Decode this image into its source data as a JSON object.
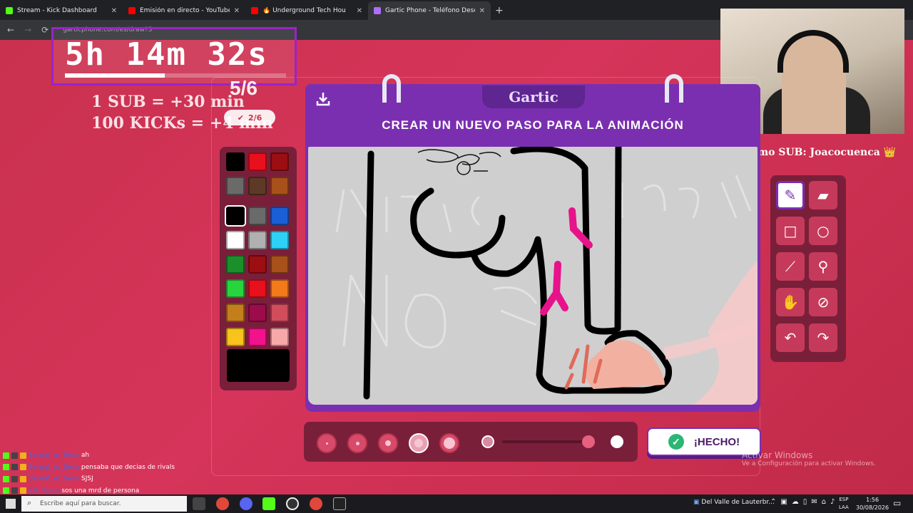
{
  "browser": {
    "tabs": [
      {
        "title": "Stream - Kick Dashboard",
        "favicon_color": "#53fc18",
        "active": false
      },
      {
        "title": "Emisión en directo - YouTube S",
        "favicon_color": "#ff0000",
        "active": false
      },
      {
        "title": "🔥 Underground Tech Hou",
        "favicon_color": "#ff0000",
        "active": false
      },
      {
        "title": "Gartic Phone - Teléfono Descor",
        "favicon_color": "#b06cff",
        "active": true
      }
    ],
    "url": "garticphone.com/es/draw?5"
  },
  "overlay": {
    "timer": "5h 14m 32s",
    "timer_progress_fraction": 0.45,
    "sub_rule_1": "1 SUB = +30 min",
    "sub_rule_2": "100 KICKs = +4 min",
    "round_counter": "5/6",
    "done_count": "2/6",
    "last_sub": "Ultimo SUB: Joacocuenca 👑"
  },
  "gartic": {
    "logo": "Gartic",
    "step_title": "CREAR UN NUEVO PASO PARA LA ANIMACIÓN",
    "done_button": "¡HECHO!",
    "palette_colors": [
      "#000000",
      "#e8101c",
      "#9b0e12",
      "#6a6a6a",
      "#5c3a26",
      "#a8511a",
      "#000000",
      "#6a6a6a",
      "#1a5fd6",
      "#ffffff",
      "#b0b0b0",
      "#2ed0f5",
      "#1a8f2a",
      "#9b0e12",
      "#a8511a",
      "#27d43d",
      "#e8101c",
      "#f27a1a",
      "#c47e1c",
      "#9c0b4a",
      "#d24d5c",
      "#f7c31c",
      "#f2128a",
      "#f7a9a9"
    ],
    "current_color": "#000000",
    "tools": [
      "pencil-icon",
      "eraser-icon",
      "square-icon",
      "circle-icon",
      "line-icon",
      "eyedropper-icon",
      "fill-icon",
      "clear-icon",
      "undo-icon",
      "redo-icon"
    ],
    "brush_size_selected": 4,
    "opacity_fraction": 0.85
  },
  "chat": [
    {
      "user": "Bernat_es_Sesn",
      "msg": "ah",
      "user_color": "#4a63e0"
    },
    {
      "user": "Bernat_es_Sesn",
      "msg": "pensaba que decias de rivals",
      "user_color": "#4a63e0"
    },
    {
      "user": "Bernat_es_Sesn",
      "msg": "SJSJ",
      "user_color": "#4a63e0"
    },
    {
      "user": "ezt_Texus",
      "msg": "sos una mrd de persona",
      "user_color": "#4a63e0"
    },
    {
      "user": "ezt_Texus",
      "msg": "",
      "user_color": "#4a63e0"
    }
  ],
  "windows": {
    "activate_title": "Activar Windows",
    "activate_sub": "Ve a Configuración para activar Windows.",
    "search_placeholder": "Escribe aquí para buscar.",
    "now_playing": "Del Valle de Lauterbr...",
    "lang_1": "ESP",
    "lang_2": "LAA",
    "time": "1:56",
    "date": "30/08/2026"
  }
}
